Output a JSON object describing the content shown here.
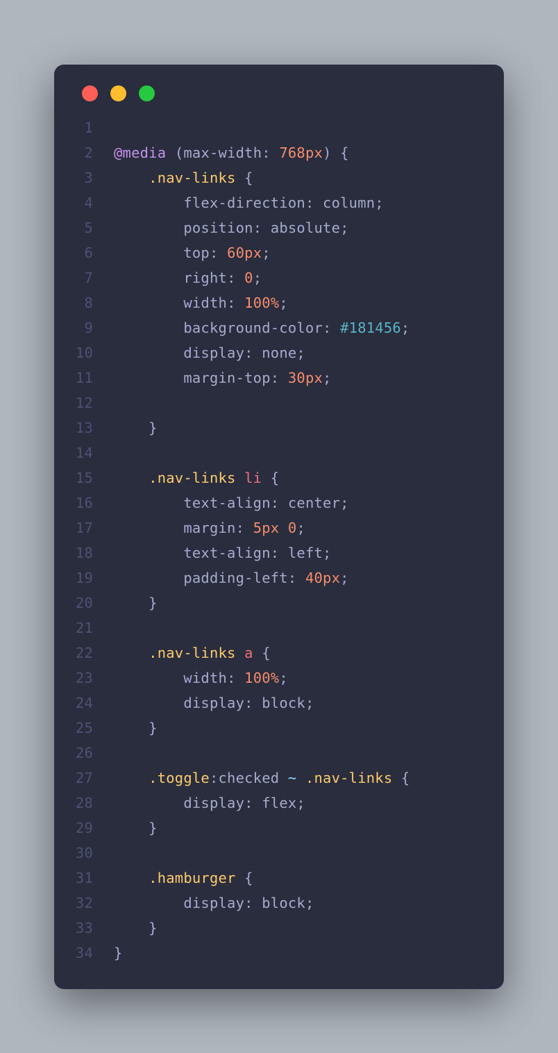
{
  "traffic_lights": [
    "red",
    "yellow",
    "green"
  ],
  "line_count": 34,
  "colors": {
    "bg": "#292d3e",
    "gutter": "#4c5374",
    "default": "#a6accd",
    "atrule": "#c792ea",
    "number": "#f78c6c",
    "class": "#ffcb6b",
    "tag": "#f07178",
    "hex": "#58b4c8",
    "operator": "#89ddff"
  },
  "lines": [
    {
      "n": 1,
      "tokens": []
    },
    {
      "n": 2,
      "tokens": [
        {
          "t": "@media",
          "c": "atrule"
        },
        {
          "t": " ",
          "c": "default"
        },
        {
          "t": "(",
          "c": "paren"
        },
        {
          "t": "max-width",
          "c": "prop"
        },
        {
          "t": ":",
          "c": "colon"
        },
        {
          "t": " ",
          "c": "default"
        },
        {
          "t": "768",
          "c": "num"
        },
        {
          "t": "px",
          "c": "unit"
        },
        {
          "t": ")",
          "c": "paren"
        },
        {
          "t": " ",
          "c": "default"
        },
        {
          "t": "{",
          "c": "brace"
        }
      ]
    },
    {
      "n": 3,
      "tokens": [
        {
          "t": "    ",
          "c": "default"
        },
        {
          "t": ".nav-links",
          "c": "class"
        },
        {
          "t": " ",
          "c": "default"
        },
        {
          "t": "{",
          "c": "brace"
        }
      ]
    },
    {
      "n": 4,
      "tokens": [
        {
          "t": "        ",
          "c": "default"
        },
        {
          "t": "flex-direction",
          "c": "prop"
        },
        {
          "t": ":",
          "c": "colon"
        },
        {
          "t": " ",
          "c": "default"
        },
        {
          "t": "column",
          "c": "value"
        },
        {
          "t": ";",
          "c": "semi"
        }
      ]
    },
    {
      "n": 5,
      "tokens": [
        {
          "t": "        ",
          "c": "default"
        },
        {
          "t": "position",
          "c": "prop"
        },
        {
          "t": ":",
          "c": "colon"
        },
        {
          "t": " ",
          "c": "default"
        },
        {
          "t": "absolute",
          "c": "value"
        },
        {
          "t": ";",
          "c": "semi"
        }
      ]
    },
    {
      "n": 6,
      "tokens": [
        {
          "t": "        ",
          "c": "default"
        },
        {
          "t": "top",
          "c": "prop"
        },
        {
          "t": ":",
          "c": "colon"
        },
        {
          "t": " ",
          "c": "default"
        },
        {
          "t": "60",
          "c": "num"
        },
        {
          "t": "px",
          "c": "unit"
        },
        {
          "t": ";",
          "c": "semi"
        }
      ]
    },
    {
      "n": 7,
      "tokens": [
        {
          "t": "        ",
          "c": "default"
        },
        {
          "t": "right",
          "c": "prop"
        },
        {
          "t": ":",
          "c": "colon"
        },
        {
          "t": " ",
          "c": "default"
        },
        {
          "t": "0",
          "c": "num"
        },
        {
          "t": ";",
          "c": "semi"
        }
      ]
    },
    {
      "n": 8,
      "tokens": [
        {
          "t": "        ",
          "c": "default"
        },
        {
          "t": "width",
          "c": "prop"
        },
        {
          "t": ":",
          "c": "colon"
        },
        {
          "t": " ",
          "c": "default"
        },
        {
          "t": "100",
          "c": "num"
        },
        {
          "t": "%",
          "c": "unit"
        },
        {
          "t": ";",
          "c": "semi"
        }
      ]
    },
    {
      "n": 9,
      "tokens": [
        {
          "t": "        ",
          "c": "default"
        },
        {
          "t": "background-color",
          "c": "prop"
        },
        {
          "t": ":",
          "c": "colon"
        },
        {
          "t": " ",
          "c": "default"
        },
        {
          "t": "#181456",
          "c": "hex"
        },
        {
          "t": ";",
          "c": "semi"
        }
      ]
    },
    {
      "n": 10,
      "tokens": [
        {
          "t": "        ",
          "c": "default"
        },
        {
          "t": "display",
          "c": "prop"
        },
        {
          "t": ":",
          "c": "colon"
        },
        {
          "t": " ",
          "c": "default"
        },
        {
          "t": "none",
          "c": "value"
        },
        {
          "t": ";",
          "c": "semi"
        }
      ]
    },
    {
      "n": 11,
      "tokens": [
        {
          "t": "        ",
          "c": "default"
        },
        {
          "t": "margin-top",
          "c": "prop"
        },
        {
          "t": ":",
          "c": "colon"
        },
        {
          "t": " ",
          "c": "default"
        },
        {
          "t": "30",
          "c": "num"
        },
        {
          "t": "px",
          "c": "unit"
        },
        {
          "t": ";",
          "c": "semi"
        }
      ]
    },
    {
      "n": 12,
      "tokens": []
    },
    {
      "n": 13,
      "tokens": [
        {
          "t": "    ",
          "c": "default"
        },
        {
          "t": "}",
          "c": "brace"
        }
      ]
    },
    {
      "n": 14,
      "tokens": []
    },
    {
      "n": 15,
      "tokens": [
        {
          "t": "    ",
          "c": "default"
        },
        {
          "t": ".nav-links",
          "c": "class"
        },
        {
          "t": " ",
          "c": "default"
        },
        {
          "t": "li",
          "c": "tag"
        },
        {
          "t": " ",
          "c": "default"
        },
        {
          "t": "{",
          "c": "brace"
        }
      ]
    },
    {
      "n": 16,
      "tokens": [
        {
          "t": "        ",
          "c": "default"
        },
        {
          "t": "text-align",
          "c": "prop"
        },
        {
          "t": ":",
          "c": "colon"
        },
        {
          "t": " ",
          "c": "default"
        },
        {
          "t": "center",
          "c": "value"
        },
        {
          "t": ";",
          "c": "semi"
        }
      ]
    },
    {
      "n": 17,
      "tokens": [
        {
          "t": "        ",
          "c": "default"
        },
        {
          "t": "margin",
          "c": "prop"
        },
        {
          "t": ":",
          "c": "colon"
        },
        {
          "t": " ",
          "c": "default"
        },
        {
          "t": "5",
          "c": "num"
        },
        {
          "t": "px",
          "c": "unit"
        },
        {
          "t": " ",
          "c": "default"
        },
        {
          "t": "0",
          "c": "num"
        },
        {
          "t": ";",
          "c": "semi"
        }
      ]
    },
    {
      "n": 18,
      "tokens": [
        {
          "t": "        ",
          "c": "default"
        },
        {
          "t": "text-align",
          "c": "prop"
        },
        {
          "t": ":",
          "c": "colon"
        },
        {
          "t": " ",
          "c": "default"
        },
        {
          "t": "left",
          "c": "value"
        },
        {
          "t": ";",
          "c": "semi"
        }
      ]
    },
    {
      "n": 19,
      "tokens": [
        {
          "t": "        ",
          "c": "default"
        },
        {
          "t": "padding-left",
          "c": "prop"
        },
        {
          "t": ":",
          "c": "colon"
        },
        {
          "t": " ",
          "c": "default"
        },
        {
          "t": "40",
          "c": "num"
        },
        {
          "t": "px",
          "c": "unit"
        },
        {
          "t": ";",
          "c": "semi"
        }
      ]
    },
    {
      "n": 20,
      "tokens": [
        {
          "t": "    ",
          "c": "default"
        },
        {
          "t": "}",
          "c": "brace"
        }
      ]
    },
    {
      "n": 21,
      "tokens": []
    },
    {
      "n": 22,
      "tokens": [
        {
          "t": "    ",
          "c": "default"
        },
        {
          "t": ".nav-links",
          "c": "class"
        },
        {
          "t": " ",
          "c": "default"
        },
        {
          "t": "a",
          "c": "tag"
        },
        {
          "t": " ",
          "c": "default"
        },
        {
          "t": "{",
          "c": "brace"
        }
      ]
    },
    {
      "n": 23,
      "tokens": [
        {
          "t": "        ",
          "c": "default"
        },
        {
          "t": "width",
          "c": "prop"
        },
        {
          "t": ":",
          "c": "colon"
        },
        {
          "t": " ",
          "c": "default"
        },
        {
          "t": "100",
          "c": "num"
        },
        {
          "t": "%",
          "c": "unit"
        },
        {
          "t": ";",
          "c": "semi"
        }
      ]
    },
    {
      "n": 24,
      "tokens": [
        {
          "t": "        ",
          "c": "default"
        },
        {
          "t": "display",
          "c": "prop"
        },
        {
          "t": ":",
          "c": "colon"
        },
        {
          "t": " ",
          "c": "default"
        },
        {
          "t": "block",
          "c": "value"
        },
        {
          "t": ";",
          "c": "semi"
        }
      ]
    },
    {
      "n": 25,
      "tokens": [
        {
          "t": "    ",
          "c": "default"
        },
        {
          "t": "}",
          "c": "brace"
        }
      ]
    },
    {
      "n": 26,
      "tokens": []
    },
    {
      "n": 27,
      "tokens": [
        {
          "t": "    ",
          "c": "default"
        },
        {
          "t": ".toggle",
          "c": "class"
        },
        {
          "t": ":checked",
          "c": "pseudo"
        },
        {
          "t": " ",
          "c": "default"
        },
        {
          "t": "~",
          "c": "tilde"
        },
        {
          "t": " ",
          "c": "default"
        },
        {
          "t": ".nav-links",
          "c": "class"
        },
        {
          "t": " ",
          "c": "default"
        },
        {
          "t": "{",
          "c": "brace"
        }
      ]
    },
    {
      "n": 28,
      "tokens": [
        {
          "t": "        ",
          "c": "default"
        },
        {
          "t": "display",
          "c": "prop"
        },
        {
          "t": ":",
          "c": "colon"
        },
        {
          "t": " ",
          "c": "default"
        },
        {
          "t": "flex",
          "c": "value"
        },
        {
          "t": ";",
          "c": "semi"
        }
      ]
    },
    {
      "n": 29,
      "tokens": [
        {
          "t": "    ",
          "c": "default"
        },
        {
          "t": "}",
          "c": "brace"
        }
      ]
    },
    {
      "n": 30,
      "tokens": []
    },
    {
      "n": 31,
      "tokens": [
        {
          "t": "    ",
          "c": "default"
        },
        {
          "t": ".hamburger",
          "c": "class"
        },
        {
          "t": " ",
          "c": "default"
        },
        {
          "t": "{",
          "c": "brace"
        }
      ]
    },
    {
      "n": 32,
      "tokens": [
        {
          "t": "        ",
          "c": "default"
        },
        {
          "t": "display",
          "c": "prop"
        },
        {
          "t": ":",
          "c": "colon"
        },
        {
          "t": " ",
          "c": "default"
        },
        {
          "t": "block",
          "c": "value"
        },
        {
          "t": ";",
          "c": "semi"
        }
      ]
    },
    {
      "n": 33,
      "tokens": [
        {
          "t": "    ",
          "c": "default"
        },
        {
          "t": "}",
          "c": "brace"
        }
      ]
    },
    {
      "n": 34,
      "tokens": [
        {
          "t": "}",
          "c": "brace"
        }
      ]
    }
  ]
}
